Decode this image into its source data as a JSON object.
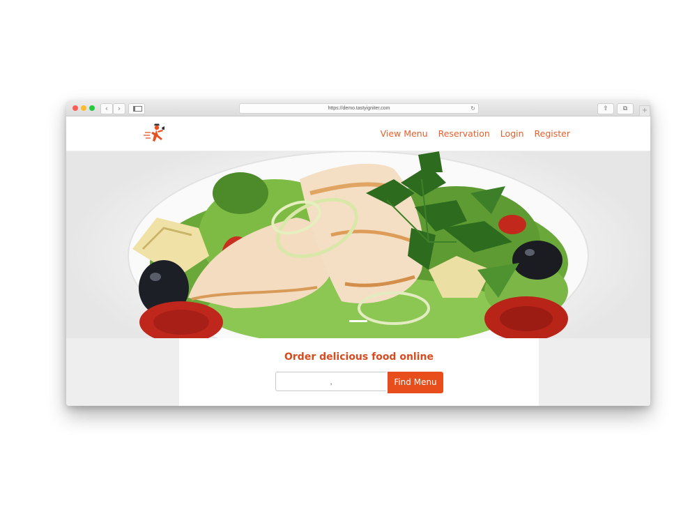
{
  "browser": {
    "url": "https://demo.tastyigniter.com",
    "back_glyph": "‹",
    "forward_glyph": "›",
    "reload_glyph": "↻",
    "share_glyph": "⇧",
    "tabs_glyph": "⧉",
    "newtab_glyph": "+"
  },
  "site": {
    "logo_icon": "chef-running-logo-icon",
    "nav": [
      "View Menu",
      "Reservation",
      "Login",
      "Register"
    ],
    "accent_color": "#e85d2b"
  },
  "hero": {
    "image": "grilled-chicken-salad-image",
    "slide_indicator": "carousel-indicator"
  },
  "order": {
    "heading": "Order delicious food online",
    "input_value": ",",
    "button_label": "Find Menu",
    "button_color": "#e84e1b"
  }
}
